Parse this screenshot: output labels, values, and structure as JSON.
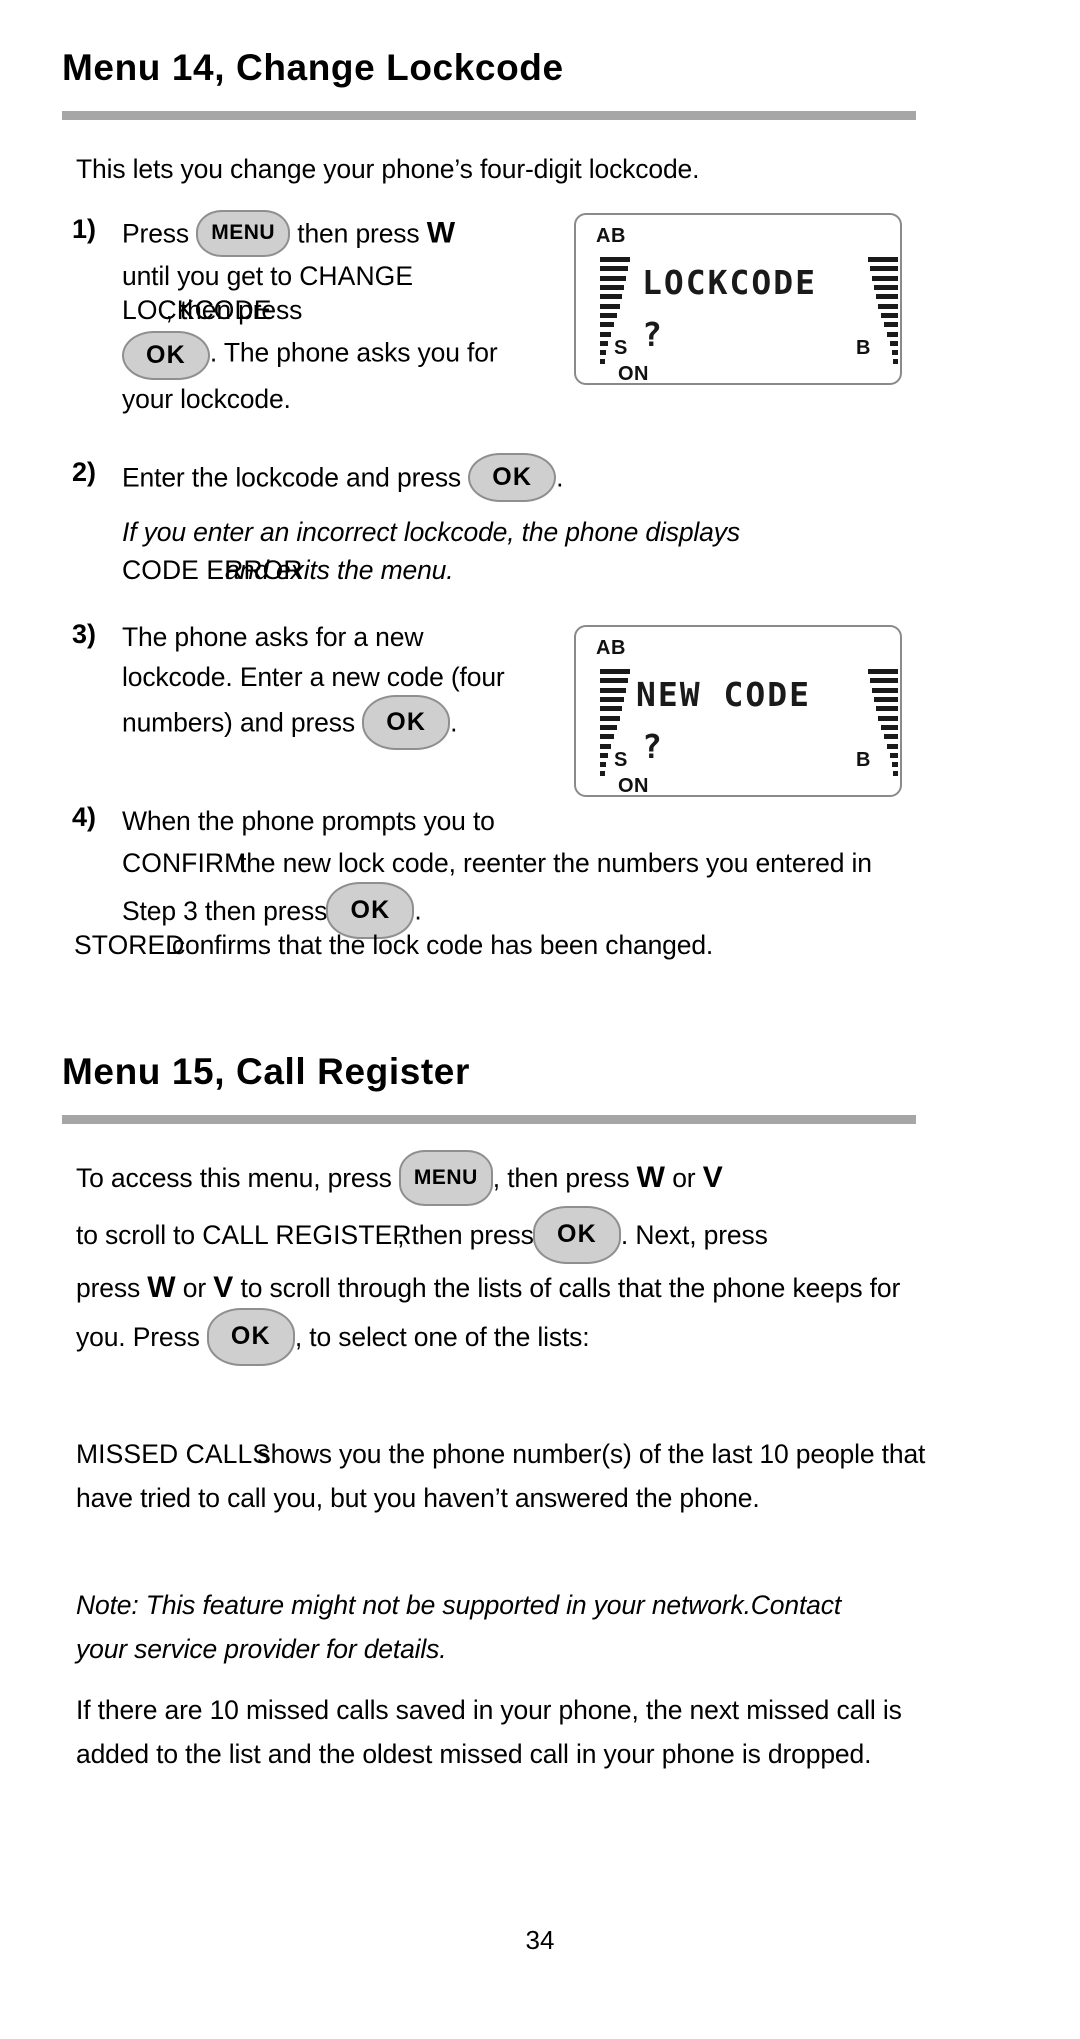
{
  "page": {
    "number": "34"
  },
  "sections": [
    {
      "heading": "Menu 14, Change Lockcode",
      "intro": "This lets you change your phone’s four-digit lockcode.",
      "steps": [
        {
          "number": "1)",
          "parts": {
            "t1": "Press ",
            "key1": "MENU",
            "t2": " then press ",
            "nav1": "W",
            "t3": "until you get to ",
            "disp1": "CHANGE LOCKCODE",
            "t4": ", then press",
            "key2": "OK",
            "t5": ". The phone asks you for your lockcode."
          }
        },
        {
          "number": "2)",
          "parts": {
            "t1": "Enter the lockcode and press ",
            "key1": "OK",
            "t2": "."
          }
        },
        {
          "number": "3)",
          "parts": {
            "t1": "The phone asks for a new lockcode. Enter a new code (four numbers) and press ",
            "key1": "OK",
            "t2": "."
          }
        },
        {
          "number": "4)",
          "parts": {
            "t1": "When the phone prompts you to ",
            "disp1": "CONFIRM",
            "t2": " the new lock code, reenter the numbers you entered in Step 3 then press ",
            "key1": "OK",
            "t3": "."
          }
        }
      ],
      "note_italic": {
        "t1": "If you enter an incorrect lockcode, the phone displays ",
        "disp1": "CODE ERROR",
        "t2": " and exits the menu."
      },
      "closing": {
        "disp1": "STORED",
        "t1": " confirms that the lock code has been changed."
      },
      "displays": [
        {
          "ab": "AB",
          "main": "LOCKCODE",
          "question": "?",
          "s": "S",
          "b": "B",
          "on": "ON"
        },
        {
          "ab": "AB",
          "main": "NEW CODE",
          "question": "?",
          "s": "S",
          "b": "B",
          "on": "ON"
        }
      ]
    },
    {
      "heading": "Menu 15, Call Register",
      "paragraph1": {
        "t1": "To access this menu, press ",
        "key1": "MENU",
        "t2": ", then press ",
        "nav1": "W",
        "t3": " or ",
        "nav2": "V",
        "t4": "to scroll to ",
        "disp1": "CALL REGISTER",
        "t5": ", then press ",
        "key2": "OK",
        "t6": ". Next, press ",
        "nav3": "W",
        "t7": " or ",
        "nav4": "V",
        "t8": "  to scroll through the lists of calls that the phone keeps for you. Press ",
        "key3": "OK",
        "t9": ", to select one of the lists:"
      },
      "paragraph2": {
        "disp1": "MISSED CALLS",
        "t1": " shows you the phone number(s) of the last 10 people that have tried to call you, but you haven’t answered the phone."
      },
      "note_italic": "Note:  This feature might not be supported in your network.Contact your service provider for details.",
      "paragraph3": "If there are 10 missed calls saved in your phone, the next missed call is added to the list and the oldest missed call in your phone is dropped."
    }
  ],
  "colors": {
    "rule": "#a6a6a6",
    "key_fill": "#cfcfcf",
    "key_border": "#8f8f8f",
    "lcd_border": "#8a8a8a"
  }
}
